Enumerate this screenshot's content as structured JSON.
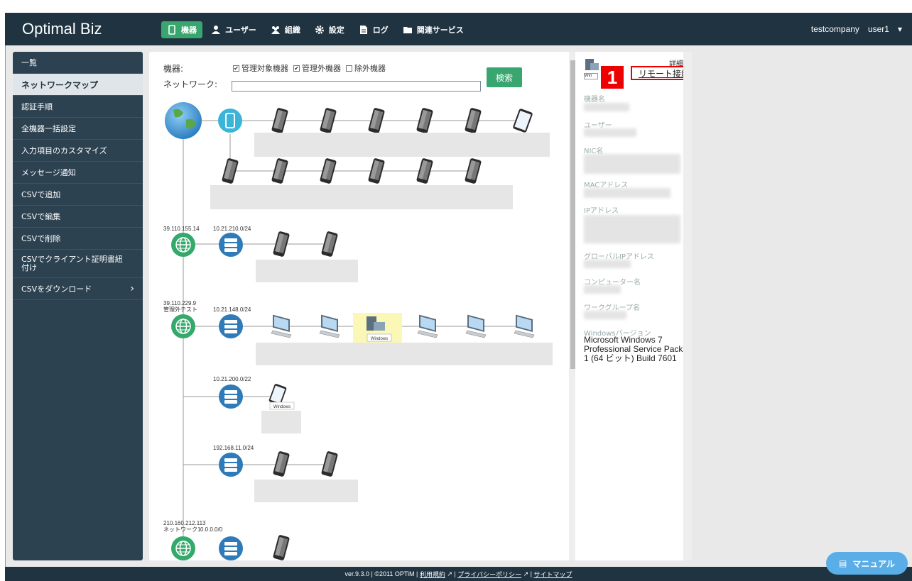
{
  "app": {
    "title": "Optimal Biz"
  },
  "nav": [
    {
      "label": "機器"
    },
    {
      "label": "ユーザー"
    },
    {
      "label": "組織"
    },
    {
      "label": "設定"
    },
    {
      "label": "ログ"
    },
    {
      "label": "関連サービス"
    }
  ],
  "account": {
    "company": "testcompany",
    "user": "user1"
  },
  "sidebar": [
    {
      "label": "一覧"
    },
    {
      "label": "ネットワークマップ"
    },
    {
      "label": "認証手順"
    },
    {
      "label": "全機器一括設定"
    },
    {
      "label": "入力項目のカスタマイズ"
    },
    {
      "label": "メッセージ通知"
    },
    {
      "label": "CSVで追加"
    },
    {
      "label": "CSVで編集"
    },
    {
      "label": "CSVで削除"
    },
    {
      "label": "CSVでクライアント証明書紐付け"
    },
    {
      "label": "CSVをダウンロード"
    }
  ],
  "filter": {
    "device_label": "機器:",
    "network_label": "ネットワーク:",
    "checks": [
      "管理対象機器",
      "管理外機器",
      "除外機器"
    ],
    "search_button": "検索"
  },
  "map": {
    "groups": [
      {
        "ip": "39.110.155.14",
        "net": "10.21.210.0/24"
      },
      {
        "ip": "39.110.229.9",
        "name": "管理外テスト",
        "net": "10.21.148.0/24",
        "net2": "10.21.200.0/22",
        "net3": "192.168.11.0/24"
      },
      {
        "ip": "210.160.212.113",
        "name": "ネットワーク1",
        "net": "0.0.0.0/0"
      }
    ],
    "windows_tag": "Windows"
  },
  "detail": {
    "header": "詳細",
    "remote_link": "リモート接続",
    "fields": [
      "機器名",
      "ユーザー",
      "NIC名",
      "MACアドレス",
      "IPアドレス",
      "グローバルIPアドレス",
      "コンピューター名",
      "ワークグループ名",
      "Windowsバージョン"
    ],
    "windows_version": "Microsoft Windows 7 Professional Service Pack 1 (64 ビット) Build 7601",
    "os_tag": "Win"
  },
  "callout": {
    "number": "1"
  },
  "footer": {
    "version": "ver.9.3.0 | ©2011 OPTiM | ",
    "terms": "利用規約",
    "privacy": "プライバシーポリシー",
    "sitemap": "サイトマップ"
  },
  "manual_button": {
    "label": "マニュアル"
  },
  "colors": {
    "header": "#1f3341",
    "accent": "#3aa66f",
    "sidebar": "#2d4251",
    "callout": "#e00000",
    "manual": "#5aaee8"
  }
}
